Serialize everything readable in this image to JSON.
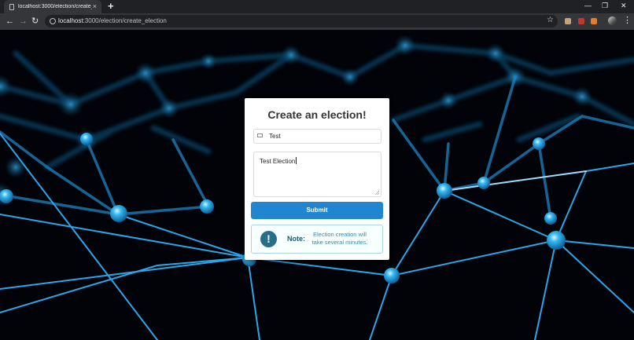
{
  "browser": {
    "tab_title": "localhost:3000/election/create_el",
    "tab_close": "×",
    "new_tab": "+",
    "window_controls": {
      "minimize": "—",
      "restore": "❐",
      "close": "✕"
    },
    "nav": {
      "back": "←",
      "forward": "→",
      "reload": "↻"
    },
    "url_host": "localhost",
    "url_rest": ":3000/election/create_election",
    "bookmark_star": "☆",
    "menu": "⋮",
    "extension_colors": [
      "#c9a27a",
      "#c0392b",
      "#e67e22"
    ]
  },
  "page": {
    "background_accent": "#1ea0e6",
    "card": {
      "title": "Create an election!",
      "name_value": "Test",
      "description_value": "Test Election",
      "submit_label": "Submit",
      "note": {
        "icon": "!",
        "label": "Note:",
        "text": "Election creation will take several minutes."
      }
    }
  }
}
